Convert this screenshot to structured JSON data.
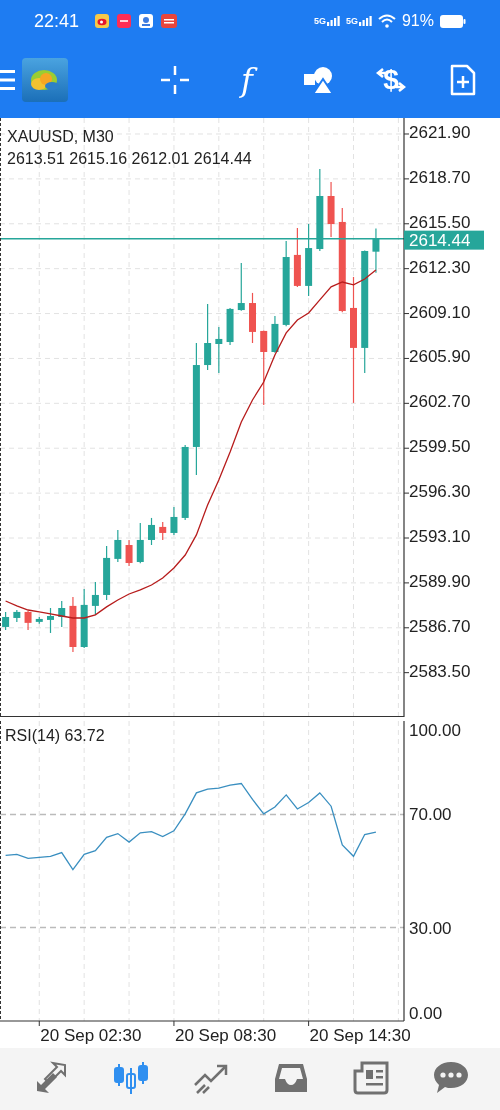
{
  "status_bar": {
    "time": "22:41",
    "notifications": [
      {
        "kind": "weibo"
      },
      {
        "kind": "red-app"
      },
      {
        "kind": "blue-app"
      },
      {
        "kind": "news-app"
      }
    ],
    "signals": [
      {
        "label": "5G"
      },
      {
        "label": "5G"
      }
    ],
    "battery": "91%"
  },
  "toolbar": {
    "buttons": [
      {
        "kind": "menu"
      },
      {
        "kind": "logo"
      },
      {
        "kind": "crosshair"
      },
      {
        "kind": "indicators",
        "label": "f"
      },
      {
        "kind": "objects"
      },
      {
        "kind": "trade",
        "label": "$"
      },
      {
        "kind": "new-order"
      }
    ]
  },
  "price_chart": {
    "ohlc": "2613.51 2615.16 2612.01 2614.44",
    "chart_data": {
      "type": "candlestick",
      "title": "XAUUSD, M30",
      "grid": true,
      "categories": [
        null,
        null,
        null,
        null,
        null,
        null,
        null,
        null,
        null,
        null,
        null,
        null,
        null,
        null,
        null,
        null,
        null,
        null,
        null,
        null,
        null,
        null,
        null,
        null,
        null,
        null,
        null,
        null,
        null,
        null,
        null,
        null,
        null,
        null,
        null,
        null
      ],
      "ohlc": [
        [
          2586.76,
          2587.83,
          2586.55,
          2587.47
        ],
        [
          2587.4,
          2587.97,
          2587.12,
          2587.83
        ],
        [
          2587.83,
          2587.9,
          2586.55,
          2587.05
        ],
        [
          2587.12,
          2587.47,
          2586.98,
          2587.33
        ],
        [
          2587.26,
          2588.11,
          2586.33,
          2587.54
        ],
        [
          2587.47,
          2588.61,
          2586.76,
          2588.11
        ],
        [
          2588.26,
          2588.9,
          2584.98,
          2585.33
        ],
        [
          2585.33,
          2589.47,
          2585.26,
          2588.33
        ],
        [
          2588.26,
          2589.97,
          2587.62,
          2589.04
        ],
        [
          2589.04,
          2592.53,
          2588.68,
          2591.68
        ],
        [
          2591.61,
          2593.67,
          2591.39,
          2592.96
        ],
        [
          2592.6,
          2592.96,
          2591.11,
          2591.32
        ],
        [
          2591.39,
          2594.17,
          2591.3,
          2592.96
        ],
        [
          2592.96,
          2594.53,
          2592.6,
          2594.03
        ],
        [
          2593.89,
          2594.24,
          2592.96,
          2593.46
        ],
        [
          2593.46,
          2595.31,
          2593.32,
          2594.6
        ],
        [
          2594.53,
          2599.73,
          2594.39,
          2599.59
        ],
        [
          2599.59,
          2607.0,
          2597.59,
          2605.43
        ],
        [
          2605.43,
          2609.78,
          2605.08,
          2607.0
        ],
        [
          2606.93,
          2608.14,
          2604.86,
          2607.29
        ],
        [
          2607.07,
          2609.5,
          2606.86,
          2609.43
        ],
        [
          2609.35,
          2612.71,
          2609.3,
          2609.85
        ],
        [
          2609.85,
          2610.57,
          2607.0,
          2607.79
        ],
        [
          2607.86,
          2607.9,
          2602.58,
          2606.36
        ],
        [
          2606.36,
          2608.93,
          2606.3,
          2608.36
        ],
        [
          2608.29,
          2614.27,
          2608.2,
          2613.13
        ],
        [
          2613.28,
          2615.2,
          2611.0,
          2611.07
        ],
        [
          2611.07,
          2615.48,
          2610.35,
          2613.77
        ],
        [
          2613.7,
          2619.41,
          2613.56,
          2617.48
        ],
        [
          2617.48,
          2618.48,
          2614.56,
          2615.48
        ],
        [
          2615.63,
          2616.63,
          2609.2,
          2609.28
        ],
        [
          2609.5,
          2611.71,
          2602.73,
          2606.65
        ],
        [
          2606.65,
          2613.6,
          2604.86,
          2613.56
        ],
        [
          2613.51,
          2615.16,
          2612.01,
          2614.44
        ],
        null,
        null
      ],
      "series": [
        {
          "type": "line",
          "color": "#b71c1c",
          "values": [
            2588.61,
            2588.26,
            2587.97,
            2587.83,
            2587.69,
            2587.54,
            2587.4,
            2587.4,
            2587.62,
            2588.19,
            2588.68,
            2589.11,
            2589.4,
            2589.75,
            2590.25,
            2590.96,
            2591.89,
            2593.32,
            2595.46,
            2597.24,
            2599.23,
            2601.37,
            2602.94,
            2604.22,
            2606.15,
            2607.72,
            2608.64,
            2609.14,
            2610.07,
            2611.0,
            2611.35,
            2611.14,
            2611.56,
            2612.21,
            null,
            null
          ]
        }
      ],
      "ylim": [
        2580.34,
        2623.04
      ],
      "yticks": [
        {
          "value": 2621.9,
          "label": "2621.90"
        },
        {
          "value": 2618.7,
          "label": "2618.70"
        },
        {
          "value": 2615.5,
          "label": "2615.50"
        },
        {
          "value": 2612.3,
          "label": "2612.30"
        },
        {
          "value": 2609.1,
          "label": "2609.10"
        },
        {
          "value": 2605.9,
          "label": "2605.90"
        },
        {
          "value": 2602.7,
          "label": "2602.70"
        },
        {
          "value": 2599.5,
          "label": "2599.50"
        },
        {
          "value": 2596.3,
          "label": "2596.30"
        },
        {
          "value": 2593.1,
          "label": "2593.10"
        },
        {
          "value": 2589.9,
          "label": "2589.90"
        },
        {
          "value": 2586.7,
          "label": "2586.70"
        },
        {
          "value": 2583.5,
          "label": "2583.50"
        }
      ],
      "ref_lines": [
        {
          "axis": "y",
          "value": 2614.44,
          "label": "2614.44",
          "color": "#26a69a"
        }
      ]
    }
  },
  "rsi_chart": {
    "time_labels": [
      "20 Sep 02:30",
      "20 Sep 08:30",
      "20 Sep 14:30"
    ],
    "chart_data": {
      "type": "line",
      "title": "RSI(14) 63.72",
      "grid": true,
      "series": [
        {
          "color": "#3a8fc0",
          "values": [
            55.5,
            55.9,
            54.5,
            54.8,
            55.2,
            56.5,
            50.5,
            55.9,
            57.2,
            61.9,
            63.2,
            60.2,
            63.5,
            63.9,
            62.2,
            64.2,
            70.2,
            77.6,
            78.9,
            79.3,
            80.3,
            80.9,
            75.3,
            70.2,
            72.6,
            76.9,
            71.9,
            74.2,
            77.6,
            72.9,
            59.2,
            55.2,
            62.9,
            63.7,
            null,
            null
          ]
        }
      ],
      "ylim": [
        -3,
        103
      ],
      "yticks": [
        {
          "value": 100,
          "label": "100.00"
        },
        {
          "value": 70,
          "label": "70.00"
        },
        {
          "value": 30,
          "label": "30.00"
        },
        {
          "value": 0,
          "label": "0.00"
        }
      ],
      "ref_lines": [
        {
          "axis": "y",
          "value": 70
        },
        {
          "axis": "y",
          "value": 30
        }
      ]
    }
  },
  "bottom_nav": [
    {
      "kind": "quotes",
      "selected": false
    },
    {
      "kind": "chart",
      "selected": true
    },
    {
      "kind": "trade",
      "selected": false
    },
    {
      "kind": "history",
      "selected": false
    },
    {
      "kind": "news",
      "selected": false
    },
    {
      "kind": "messages",
      "selected": false
    }
  ]
}
